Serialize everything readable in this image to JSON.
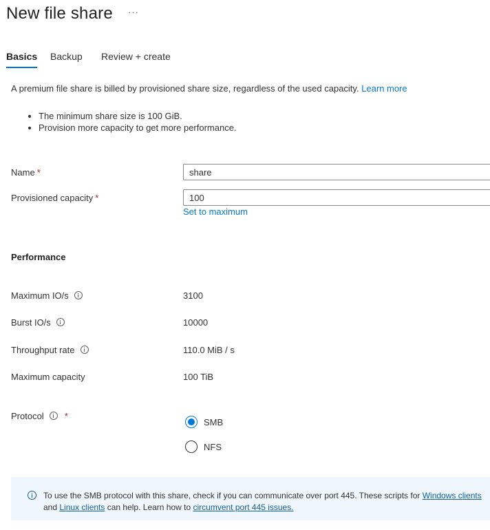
{
  "header": {
    "title": "New file share",
    "more_label": "···"
  },
  "tabs": [
    {
      "label": "Basics",
      "active": true
    },
    {
      "label": "Backup",
      "active": false
    },
    {
      "label": "Review + create",
      "active": false
    }
  ],
  "intro": {
    "text": "A premium file share is billed by provisioned share size, regardless of the used capacity. ",
    "learn_more": "Learn more",
    "bullets": [
      "The minimum share size is 100 GiB.",
      "Provision more capacity to get more performance."
    ]
  },
  "form": {
    "name": {
      "label": "Name",
      "required": "*",
      "value": "share"
    },
    "capacity": {
      "label": "Provisioned capacity",
      "required": "*",
      "value": "100",
      "set_max_label": "Set to maximum"
    }
  },
  "performance": {
    "title": "Performance",
    "rows": [
      {
        "label": "Maximum IO/s",
        "value": "3100",
        "info": true
      },
      {
        "label": "Burst IO/s",
        "value": "10000",
        "info": true
      },
      {
        "label": "Throughput rate",
        "value": "110.0 MiB / s",
        "info": true
      },
      {
        "label": "Maximum capacity",
        "value": "100 TiB",
        "info": false
      }
    ]
  },
  "protocol": {
    "label": "Protocol",
    "required": "*",
    "options": [
      {
        "label": "SMB",
        "checked": true
      },
      {
        "label": "NFS",
        "checked": false
      }
    ]
  },
  "info_bar": {
    "text1": "To use the SMB protocol with this share, check if you can communicate over port 445. These scripts for ",
    "link1": "Windows clients",
    "text2": " and ",
    "link2": "Linux clients",
    "text3": " can help. Learn how to ",
    "link3": "circumvent port 445 issues."
  },
  "colors": {
    "accent": "#0078d4",
    "link": "#0f5f9a",
    "info_bg": "#f0f6fd",
    "required": "#a4262c"
  }
}
